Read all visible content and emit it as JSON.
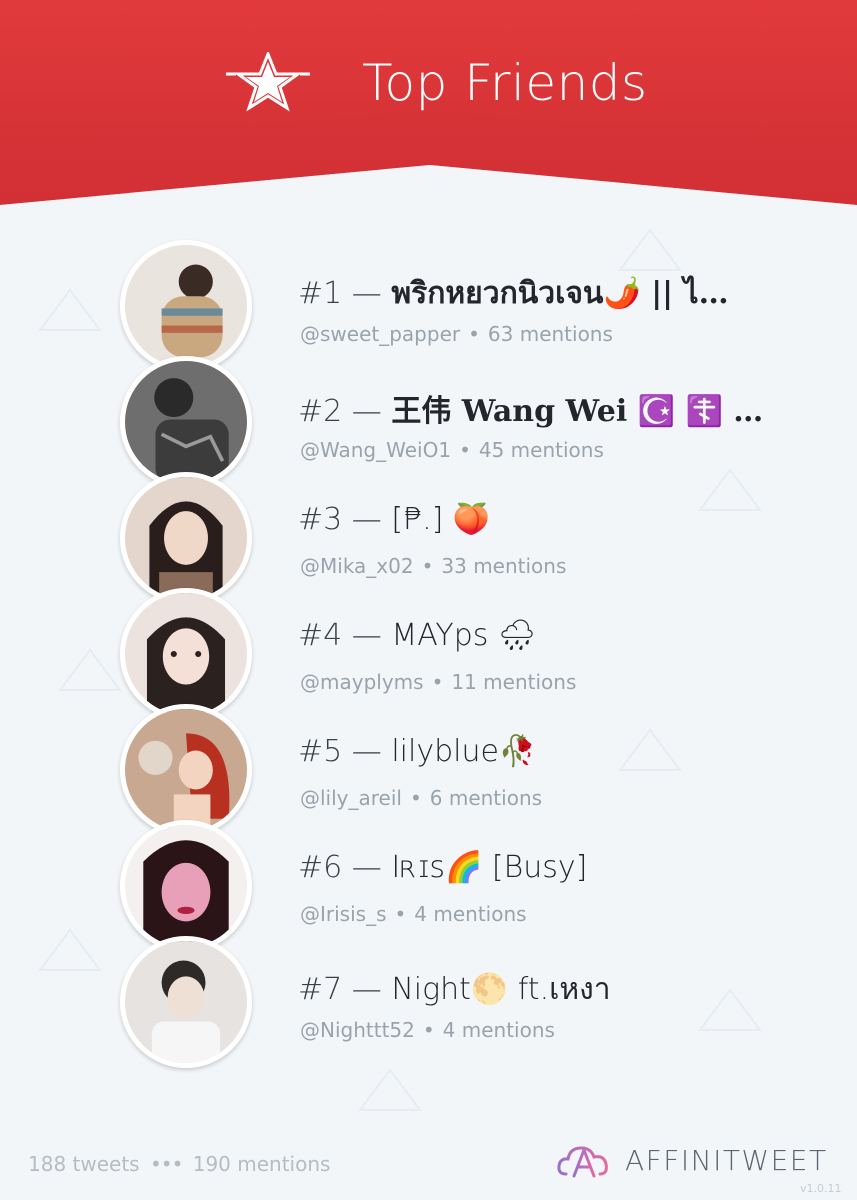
{
  "header": {
    "title": "Top Friends",
    "icon": "star-icon"
  },
  "friends": [
    {
      "rank": "#1",
      "dash": "—",
      "display_name": "พริกหยวกนิวเจน🌶️ || ไ…",
      "handle": "@sweet_papper",
      "mentions": "63 mentions",
      "bold": true,
      "avatar": [
        "#c9b090",
        "#6a8a9a"
      ]
    },
    {
      "rank": "#2",
      "dash": "—",
      "display_name": "王伟 Wang Wei ☪️ ☦️ …",
      "handle": "@Wang_WeiO1",
      "mentions": "45 mentions",
      "bold": true,
      "avatar": [
        "#5a5a5a",
        "#2a2a2a"
      ]
    },
    {
      "rank": "#3",
      "dash": "—",
      "display_name": "[₱.] 🍑",
      "handle": "@Mika_x02",
      "mentions": "33 mentions",
      "bold": false,
      "avatar": [
        "#d9c2b4",
        "#2a1e1c"
      ]
    },
    {
      "rank": "#4",
      "dash": "—",
      "display_name": "MAYps 🌧",
      "handle": "@mayplyms",
      "mentions": "11 mentions",
      "bold": false,
      "avatar": [
        "#e8d4d0",
        "#2b2220"
      ]
    },
    {
      "rank": "#5",
      "dash": "—",
      "display_name": "lilyblue🥀",
      "handle": "@lily_areil",
      "mentions": "6 mentions",
      "bold": false,
      "avatar": [
        "#c8a890",
        "#b83020"
      ]
    },
    {
      "rank": "#6",
      "dash": "—",
      "display_name": "Iʀɪs🌈 [Busy]",
      "handle": "@Irisis_s",
      "mentions": "4 mentions",
      "bold": false,
      "avatar": [
        "#e8a0b8",
        "#2a1418"
      ]
    },
    {
      "rank": "#7",
      "dash": "—",
      "display_name": "Night🌕 ft.เหงา",
      "handle": "@Nighttt52",
      "mentions": "4 mentions",
      "bold": false,
      "avatar": [
        "#e6e3e0",
        "#2e2a28"
      ]
    }
  ],
  "footer": {
    "tweets": "188 tweets",
    "separator": "•••",
    "mentions": "190 mentions",
    "brand": "AFFINITWEET",
    "version": "v1.0.11"
  },
  "colors": {
    "header_red": "#e0373a",
    "header_red_dark": "#c92a2e",
    "background": "#f2f6f9",
    "text_dark": "#333a40",
    "text_muted": "#9aa3ab",
    "brand_purple": "#9a6fd0",
    "brand_pink": "#e46aa0"
  }
}
